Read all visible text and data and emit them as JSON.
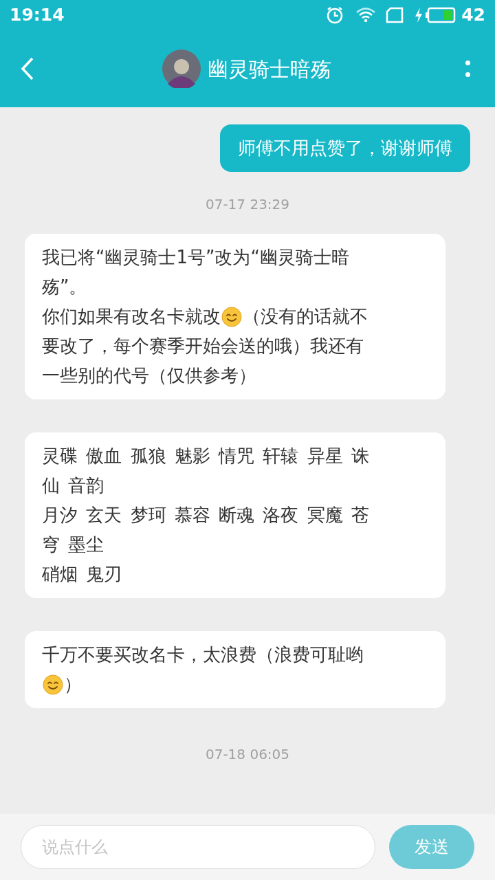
{
  "status_bar": {
    "time": "19:14",
    "battery_text": "42"
  },
  "header": {
    "title": "幽灵骑士暗殇"
  },
  "messages": [
    {
      "kind": "outgoing",
      "lines": [
        [
          {
            "kind": "text",
            "text": "师傅不用点赞了，谢谢师傅"
          }
        ]
      ]
    },
    {
      "kind": "time",
      "text": "07-17 23:29"
    },
    {
      "kind": "incoming",
      "lines": [
        [
          {
            "kind": "text",
            "text": "我已将“幽灵骑士1号”改为“幽灵骑士暗"
          }
        ],
        [
          {
            "kind": "text",
            "text": "殇”。"
          }
        ],
        [
          {
            "kind": "text",
            "text": "你们如果有改名卡就改"
          },
          {
            "kind": "emoji"
          },
          {
            "kind": "text",
            "text": "（没有的话就不"
          }
        ],
        [
          {
            "kind": "text",
            "text": "要改了，每个赛季开始会送的哦）我还有"
          }
        ],
        [
          {
            "kind": "text",
            "text": "一些别的代号（仅供参考）"
          }
        ]
      ]
    },
    {
      "kind": "incoming",
      "lines": [
        [
          {
            "kind": "text",
            "text": "灵碟 傲血 孤狼 魅影 情咒 轩辕 异星 诛"
          }
        ],
        [
          {
            "kind": "text",
            "text": "仙 音韵"
          }
        ],
        [
          {
            "kind": "text",
            "text": "月汐 玄天 梦珂 慕容 断魂 洛夜 冥魔 苍"
          }
        ],
        [
          {
            "kind": "text",
            "text": "穹 墨尘"
          }
        ],
        [
          {
            "kind": "text",
            "text": "硝烟 鬼刃"
          }
        ]
      ]
    },
    {
      "kind": "incoming",
      "lines": [
        [
          {
            "kind": "text",
            "text": "千万不要买改名卡，太浪费（浪费可耻哟"
          }
        ],
        [
          {
            "kind": "emoji"
          },
          {
            "kind": "text",
            "text": "）"
          }
        ]
      ]
    },
    {
      "kind": "time",
      "text": "07-18 06:05"
    }
  ],
  "composer": {
    "placeholder": "说点什么",
    "send_label": "发送",
    "send_disabled": true
  }
}
